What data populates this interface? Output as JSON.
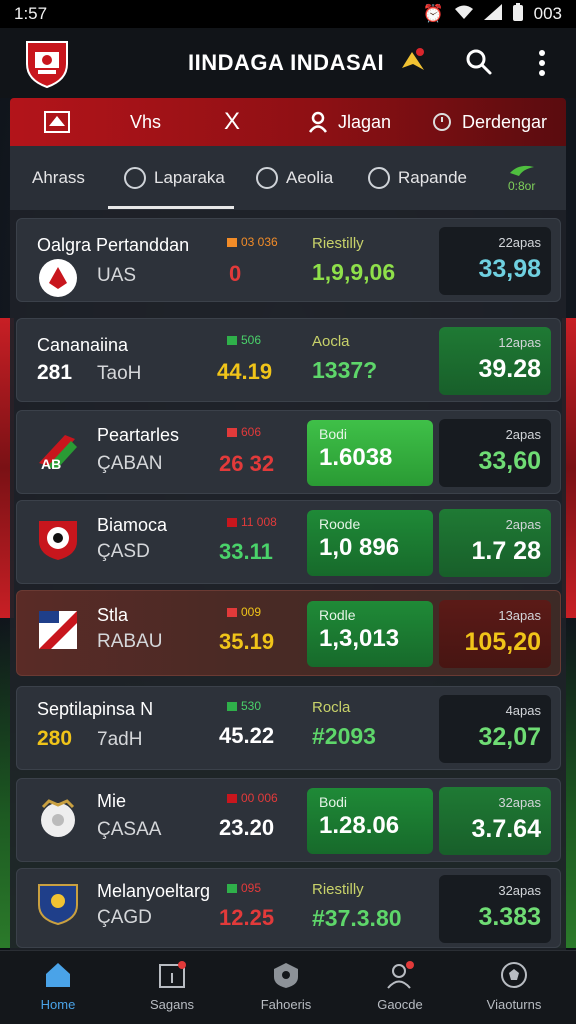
{
  "status": {
    "time": "1:57",
    "battery": "003"
  },
  "app": {
    "title": "IINDAGA INDASAI"
  },
  "top_menu": [
    {
      "label": "Vhs",
      "icon": "flag-icon"
    },
    {
      "label": "X",
      "icon": "x-icon"
    },
    {
      "label": "Jlagan",
      "icon": "user-icon"
    },
    {
      "label": "Derdengar",
      "icon": "clock-icon"
    }
  ],
  "tabs": [
    {
      "label": "Ahrass"
    },
    {
      "label": "Laparaka"
    },
    {
      "label": "Aeolia"
    },
    {
      "label": "Rapande"
    },
    {
      "label": "0:8or"
    }
  ],
  "matches": [
    {
      "team": "Oalgra Pertanddan",
      "sub": "UAS",
      "sub_score": "",
      "badge": "03 036",
      "score": "0",
      "score_color": "#e23a3a",
      "mid_label": "Riestilly",
      "mid_value": "1,9,9,06",
      "right_label": "22apas",
      "right_value": "33,98",
      "right_color": "#6fd0e0"
    },
    {
      "team": "Cananaiina",
      "sub": "TaoH",
      "sub_score": "281",
      "badge": "506",
      "score": "44.19",
      "score_color": "#f0c419",
      "mid_label": "Aocla",
      "mid_value": "1337?",
      "right_label": "12apas",
      "right_value": "39.28",
      "right_color": "#ffffff"
    },
    {
      "team": "Peartarles",
      "sub": "ÇABAN",
      "sub_score": "",
      "badge": "606",
      "score": "26 32",
      "score_color": "#e23a3a",
      "mid_label": "Bodi",
      "mid_value": "1.6038",
      "right_label": "2apas",
      "right_value": "33,60",
      "right_color": "#6fdc74"
    },
    {
      "team": "Biamoca",
      "sub": "ÇASD",
      "sub_score": "",
      "badge": "11 008",
      "score": "33.11",
      "score_color": "#4ad26a",
      "mid_label": "Roode",
      "mid_value": "1,0 896",
      "right_label": "2apas",
      "right_value": "1.7 28",
      "right_color": "#ffffff"
    },
    {
      "team": "Stla",
      "sub": "RABAU",
      "sub_score": "",
      "badge": "009",
      "score": "35.19",
      "score_color": "#f0c419",
      "mid_label": "Rodle",
      "mid_value": "1,3,013",
      "right_label": "13apas",
      "right_value": "105,20",
      "right_color": "#f0c419"
    },
    {
      "team": "Septilapinsa N",
      "sub": "7adH",
      "sub_score": "280",
      "badge": "530",
      "score": "45.22",
      "score_color": "#ffffff",
      "mid_label": "Rocla",
      "mid_value": "#2093",
      "right_label": "4apas",
      "right_value": "32,07",
      "right_color": "#6fdc74"
    },
    {
      "team": "Mie",
      "sub": "ÇASAA",
      "sub_score": "",
      "badge": "00 006",
      "score": "23.20",
      "score_color": "#ffffff",
      "mid_label": "Bodi",
      "mid_value": "1.28.06",
      "right_label": "32apas",
      "right_value": "3.7.64",
      "right_color": "#ffffff"
    },
    {
      "team": "Melanyoeltarg",
      "sub": "ÇAGD",
      "sub_score": "",
      "badge": "095",
      "score": "12.25",
      "score_color": "#e23a3a",
      "mid_label": "Riestilly",
      "mid_value": "#37.3.80",
      "right_label": "32apas",
      "right_value": "3.383",
      "right_color": "#6fdc74"
    }
  ],
  "bottom_nav": [
    {
      "label": "Home"
    },
    {
      "label": "Sagans"
    },
    {
      "label": "Fahoeris"
    },
    {
      "label": "Gaocde"
    },
    {
      "label": "Viaoturns"
    }
  ]
}
